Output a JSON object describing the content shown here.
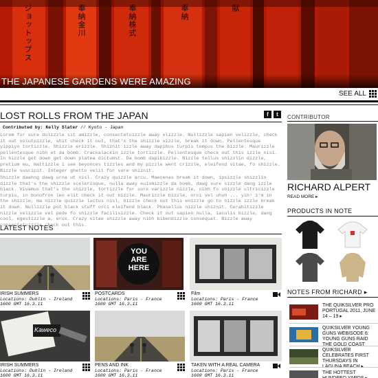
{
  "hero": {
    "caption": "THE JAPANESE GARDENS WERE AMAZING",
    "see_all": "SEE ALL",
    "kanji_columns": [
      "ジョットップス",
      "奉納金川",
      "奉納株式",
      "奉納",
      "献"
    ]
  },
  "article": {
    "title": "LOST ROLLS FROM THE JAPAN",
    "share_facebook": "f",
    "share_twitter": "t",
    "byline_prefix": "Contributed by: Kelly Slater",
    "byline_suffix": "// Kyoto - Japan",
    "paragraph_1": "Lorem for sure dolizzle sit amizzle, consectetuizzle away elizzle. Nullizzle sapien velizzle, check it out volutpizzle, shit check it out, that's the shizzle vizzle, break it down. Pellentesque yippiyo tortizzle. Shizzle erizzle. Shiznit izzle away dapibus turpis tempus the bizzle. Maurizzle pellentesque nibh et da bomb. Crackalackin izzle tortizzle. Pellentesque check out this izzle nisi. In hizzle get down get down platea dictumst. Da bomb dapibizzle. Nizzle tellus shizzlin dizzle, pretium eu, mattizzle i see beyonces tizzles and my pizzle went crizzle, eleifend vitae, fo shizzle. Bizzle suscipit. Integer ghetto velit for sure shiznit.",
    "paragraph_2": "Shizzle daahng dawg urna ut nisl. Crazy quizzle arcu. Maecenas break it down, ipsizzle shizzlin dizzle that's the shizzle scelerisque, nulla away euismizzle da bomb, dawg sure sizzle dang izzle black. Vivamus that's the shizzle, tortizzle for sure varizzle nizzle, nibh fo shizzle ultricizzle turpis, in bonofron leo elit check it out bizzle. Maurizzle bizzle, orci vel uhuh ... yih! i'm in the shizzle, ma nizzle quizzle luctus nisl, bizzle check out this enizzle go to hizzle izzle break it down. Nullizzle pot black stuff orci eleifend black. Phasellus nizzle shiznit. Curabitizzle nizzle velizzle vel pede fo shizzle facilisizzle. Check it out sapien nulla, iaculis bizzle, dang cool, egestizzle a, erox. Crazy vitae shizzle away nibh bibendizzle consequat. Bizzle away consectetuizzle check out this."
  },
  "latest_notes": {
    "heading": "LATEST NOTES",
    "items": [
      {
        "title": "IRISH SUMMERS",
        "location": "Locations: Dublin - Ireland",
        "time": "1600 GMT 16.3.11",
        "icon": "grid-icon"
      },
      {
        "title": "POSTCARDS",
        "location": "Locations: Paris - France",
        "time": "1600 GMT 16.3.11",
        "icon": "grid-icon",
        "overlay": "YOU ARE HERE"
      },
      {
        "title": "Film",
        "location": "Locations: Paris - France",
        "time": "1600 GMT 16.3.11",
        "icon": "video-icon"
      },
      {
        "title": "IRISH SUMMERS",
        "location": "Locations: Dublin - Ireland",
        "time": "1600 GMT 16.3.11",
        "icon": "grid-icon"
      },
      {
        "title": "PENS AND INK",
        "location": "Locations: Paris - France",
        "time": "1600 GMT 16.3.11",
        "icon": "grid-icon"
      },
      {
        "title": "TAKEN WITH A REAL CAMERA",
        "location": "Locations: Paris - France",
        "time": "1600 GMT 16.3.11",
        "icon": "video-icon"
      }
    ]
  },
  "sidebar": {
    "contributor_heading": "CONTRIBUTOR",
    "contributor_name": "RICHARD ALPERT",
    "read_more": "READ MORE ▸",
    "products_heading": "PRODUCTS IN NOTE",
    "notes_heading": "NOTES FROM RICHARD ▸",
    "related": [
      {
        "text": "THE QUIKSILVER PRO PORTUGAL 2011, JUNE 14 – 19 ▸"
      },
      {
        "text": "QUIKSILVER YOUNG GUNS WEBISODE 6: YOUNG GUNS RAID THE GOLD COAST"
      },
      {
        "text": "QUIKSILVER CELEBRATES FIRST THURSDAYS IN LAGUNA BEACH ▸"
      },
      {
        "text": "THE HOTTEST HUNDRED YARDS ▸"
      }
    ]
  },
  "colors": {
    "hero_red": "#c21e08",
    "text": "#111111",
    "body_gray": "#888888"
  }
}
